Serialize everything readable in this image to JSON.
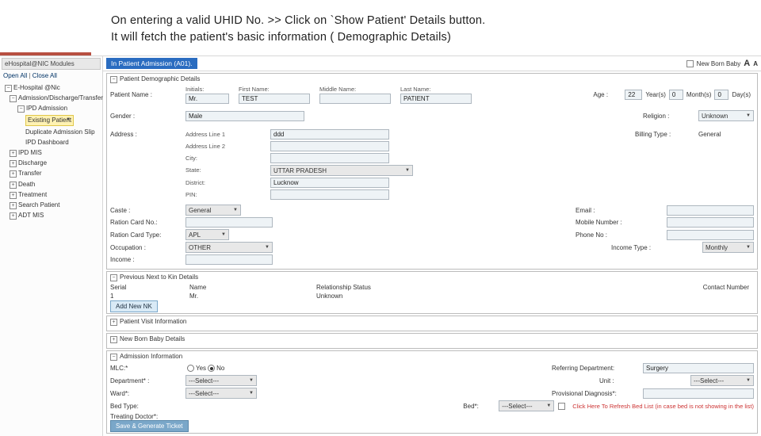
{
  "caption": {
    "l1": "On  entering  a  valid  UHID  No. >> Click  on  `Show Patient'  Details   button.",
    "l2": "It  will   fetch   the   patient's   basic   information ( Demographic Details)"
  },
  "side": {
    "hdr": "eHospital@NIC Modules",
    "open": "Open All",
    "sep": " | ",
    "close": "Close All",
    "root": "E-Hospital @Nic",
    "n_adm": "Admission/Discharge/Transfer",
    "n_ipd": "IPD Admission",
    "n_exist": "Existing Patient",
    "n_dup": "Duplicate Admission Slip",
    "n_dash": "IPD Dashboard",
    "items": [
      "IPD MIS",
      "Discharge",
      "Transfer",
      "Death",
      "Treatment",
      "Search Patient",
      "ADT MIS"
    ]
  },
  "hdr": {
    "title": "In Patient Admission (A01).",
    "newborn": "New Born Baby"
  },
  "demo": {
    "title": "Patient Demographic Details",
    "nameLbl": "Patient Name :",
    "initials_l": "Initials:",
    "first_l": "First Name:",
    "mid_l": "Middle Name:",
    "last_l": "Last Name:",
    "initials": "Mr.",
    "first": "TEST",
    "mid": "",
    "last": "PATIENT",
    "ageLbl": "Age :",
    "yrs": "22",
    "yrs_l": "Year(s)",
    "mon": "0",
    "mon_l": "Month(s)",
    "day": "0",
    "day_l": "Day(s)",
    "genderLbl": "Gender :",
    "gender": "Male",
    "religLbl": "Religion :",
    "relig": "Unknown",
    "addrLbl": "Address :",
    "al1": "Address Line 1",
    "al1v": "ddd",
    "al2": "Address Line 2",
    "city_l": "City:",
    "state_l": "State:",
    "state": "UTTAR PRADESH",
    "dist_l": "District:",
    "dist": "Lucknow",
    "pin_l": "PIN:",
    "billLbl": "Billing Type :",
    "bill": "General",
    "casteLbl": "Caste :",
    "caste": "General",
    "emailLbl": "Email :",
    "rationNoLbl": "Ration Card No.:",
    "mobLbl": "Mobile Number :",
    "rationTypeLbl": "Ration Card Type:",
    "rationType": "APL",
    "phoneLbl": "Phone No :",
    "occLbl": "Occupation :",
    "occ": "OTHER",
    "incTypeLbl": "Income Type :",
    "incType": "Monthly",
    "incLbl": "Income :"
  },
  "nok": {
    "title": "Previous Next to Kin Details",
    "c1": "Serial",
    "c2": "Name",
    "c3": "Relationship Status",
    "c4": "Contact Number",
    "r1": "1",
    "r2": "Mr.",
    "r3": "Unknown",
    "btn": "Add New NK"
  },
  "visit": {
    "title": "Patient Visit Information"
  },
  "newb": {
    "title": "New Born Baby Details"
  },
  "adm": {
    "title": "Admission Information",
    "mlc": "MLC:*",
    "yes": "Yes",
    "no": "No",
    "refLbl": "Referring Department:",
    "ref": "Surgery",
    "deptLbl": "Department* :",
    "dept": "---Select---",
    "unitLbl": "Unit :",
    "unit": "---Select---",
    "wardLbl": "Ward*:",
    "ward": "---Select---",
    "provLbl": "Provisional Diagnosis*:",
    "bedTypeLbl": "Bed Type:",
    "bedLbl": "Bed*:",
    "bed": "---Select---",
    "refresh": "Click Here To Refresh Bed List (in case bed is not showing in the list)",
    "treatLbl": "Treating Doctor*:",
    "save": "Save & Generate Ticket"
  }
}
